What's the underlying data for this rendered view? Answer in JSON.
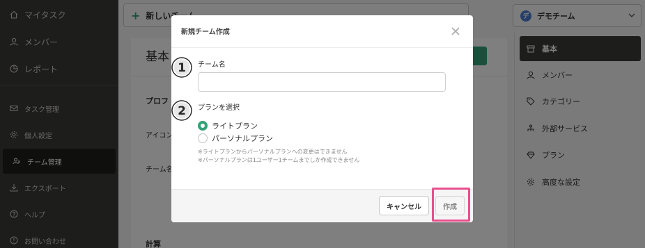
{
  "sidebar": {
    "items": [
      {
        "label": "マイタスク",
        "icon": "home-icon"
      },
      {
        "label": "メンバー",
        "icon": "person-icon"
      },
      {
        "label": "レポート",
        "icon": "report-icon"
      },
      {
        "label": "タスク管理",
        "icon": "mail-icon"
      },
      {
        "label": "個人設定",
        "icon": "gear-icon"
      },
      {
        "label": "チーム管理",
        "icon": "team-icon"
      },
      {
        "label": "エクスポート",
        "icon": "export-icon"
      },
      {
        "label": "ヘルプ",
        "icon": "help-icon"
      },
      {
        "label": "お問い合わせ",
        "icon": "contact-icon"
      }
    ]
  },
  "topbar": {
    "new_button_label": "新しいチーム"
  },
  "team_switcher": {
    "logo_letter": "デ",
    "label": "デモチーム"
  },
  "main": {
    "title": "基本",
    "section_profile": "プロフ",
    "icon_label": "アイコン",
    "team_name_label": "チーム名",
    "section_billing": "計算"
  },
  "settings_nav": {
    "items": [
      {
        "label": "基本",
        "icon": "box-icon"
      },
      {
        "label": "メンバー",
        "icon": "person-icon"
      },
      {
        "label": "カテゴリー",
        "icon": "tag-icon"
      },
      {
        "label": "外部サービス",
        "icon": "network-icon"
      },
      {
        "label": "プラン",
        "icon": "diamond-icon"
      },
      {
        "label": "高度な設定",
        "icon": "gear-icon"
      }
    ]
  },
  "modal": {
    "title": "新規チーム作成",
    "step1_number": "1",
    "step2_number": "2",
    "team_name_label": "チーム名",
    "team_name_value": "",
    "plan_label": "プランを選択",
    "plans": [
      {
        "label": "ライトプラン",
        "selected": true
      },
      {
        "label": "パーソナルプラン",
        "selected": false
      }
    ],
    "note_1": "※ライトプランからパーソナルプランへの変更はできません",
    "note_2": "※パーソナルプランは1ユーザー1チームまでしか作成できません",
    "cancel_label": "キャンセル",
    "create_label": "作成"
  },
  "colors": {
    "accent_green": "#35a176",
    "highlight_pink": "#e8508c",
    "sidebar_bg": "#3b3a38"
  }
}
